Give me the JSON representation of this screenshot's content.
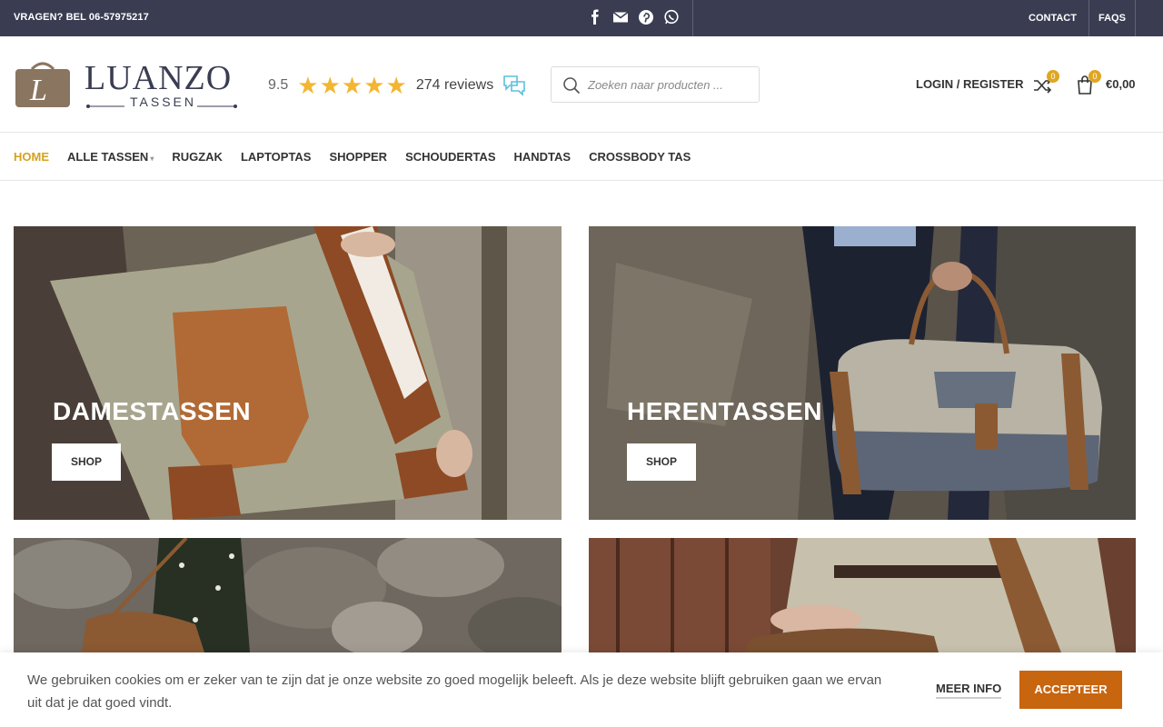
{
  "topbar": {
    "phone": "VRAGEN? BEL 06-57975217",
    "socials": [
      "facebook-icon",
      "email-icon",
      "pinterest-icon",
      "whatsapp-icon"
    ],
    "contact": "CONTACT",
    "faqs": "FAQS",
    "bg_color": "#3a3d52"
  },
  "header": {
    "logo_main": "LUANZO",
    "logo_sub": "TASSEN",
    "rating_score": "9.5",
    "stars": "★★★★★",
    "reviews": "274 reviews",
    "search_placeholder": "Zoeken naar producten ...",
    "login": "LOGIN / REGISTER",
    "compare_count": "0",
    "cart_count": "0",
    "cart_total": "€0,00"
  },
  "nav": {
    "items": [
      "HOME",
      "ALLE TASSEN",
      "RUGZAK",
      "LAPTOPTAS",
      "SHOPPER",
      "SCHOUDERTAS",
      "HANDTAS",
      "CROSSBODY TAS"
    ],
    "active": "HOME",
    "active_color": "#d4a21e"
  },
  "tiles": [
    {
      "title": "DAMESTASSEN",
      "button": "SHOP"
    },
    {
      "title": "HERENTASSEN",
      "button": "SHOP"
    }
  ],
  "cookie": {
    "message": "We gebruiken cookies om er zeker van te zijn dat je onze website zo goed mogelijk beleeft. Als je deze website blijft gebruiken gaan we ervan uit dat je dat goed vindt.",
    "more": "MEER INFO",
    "accept": "ACCEPTEER",
    "accept_color": "#c8650f"
  }
}
